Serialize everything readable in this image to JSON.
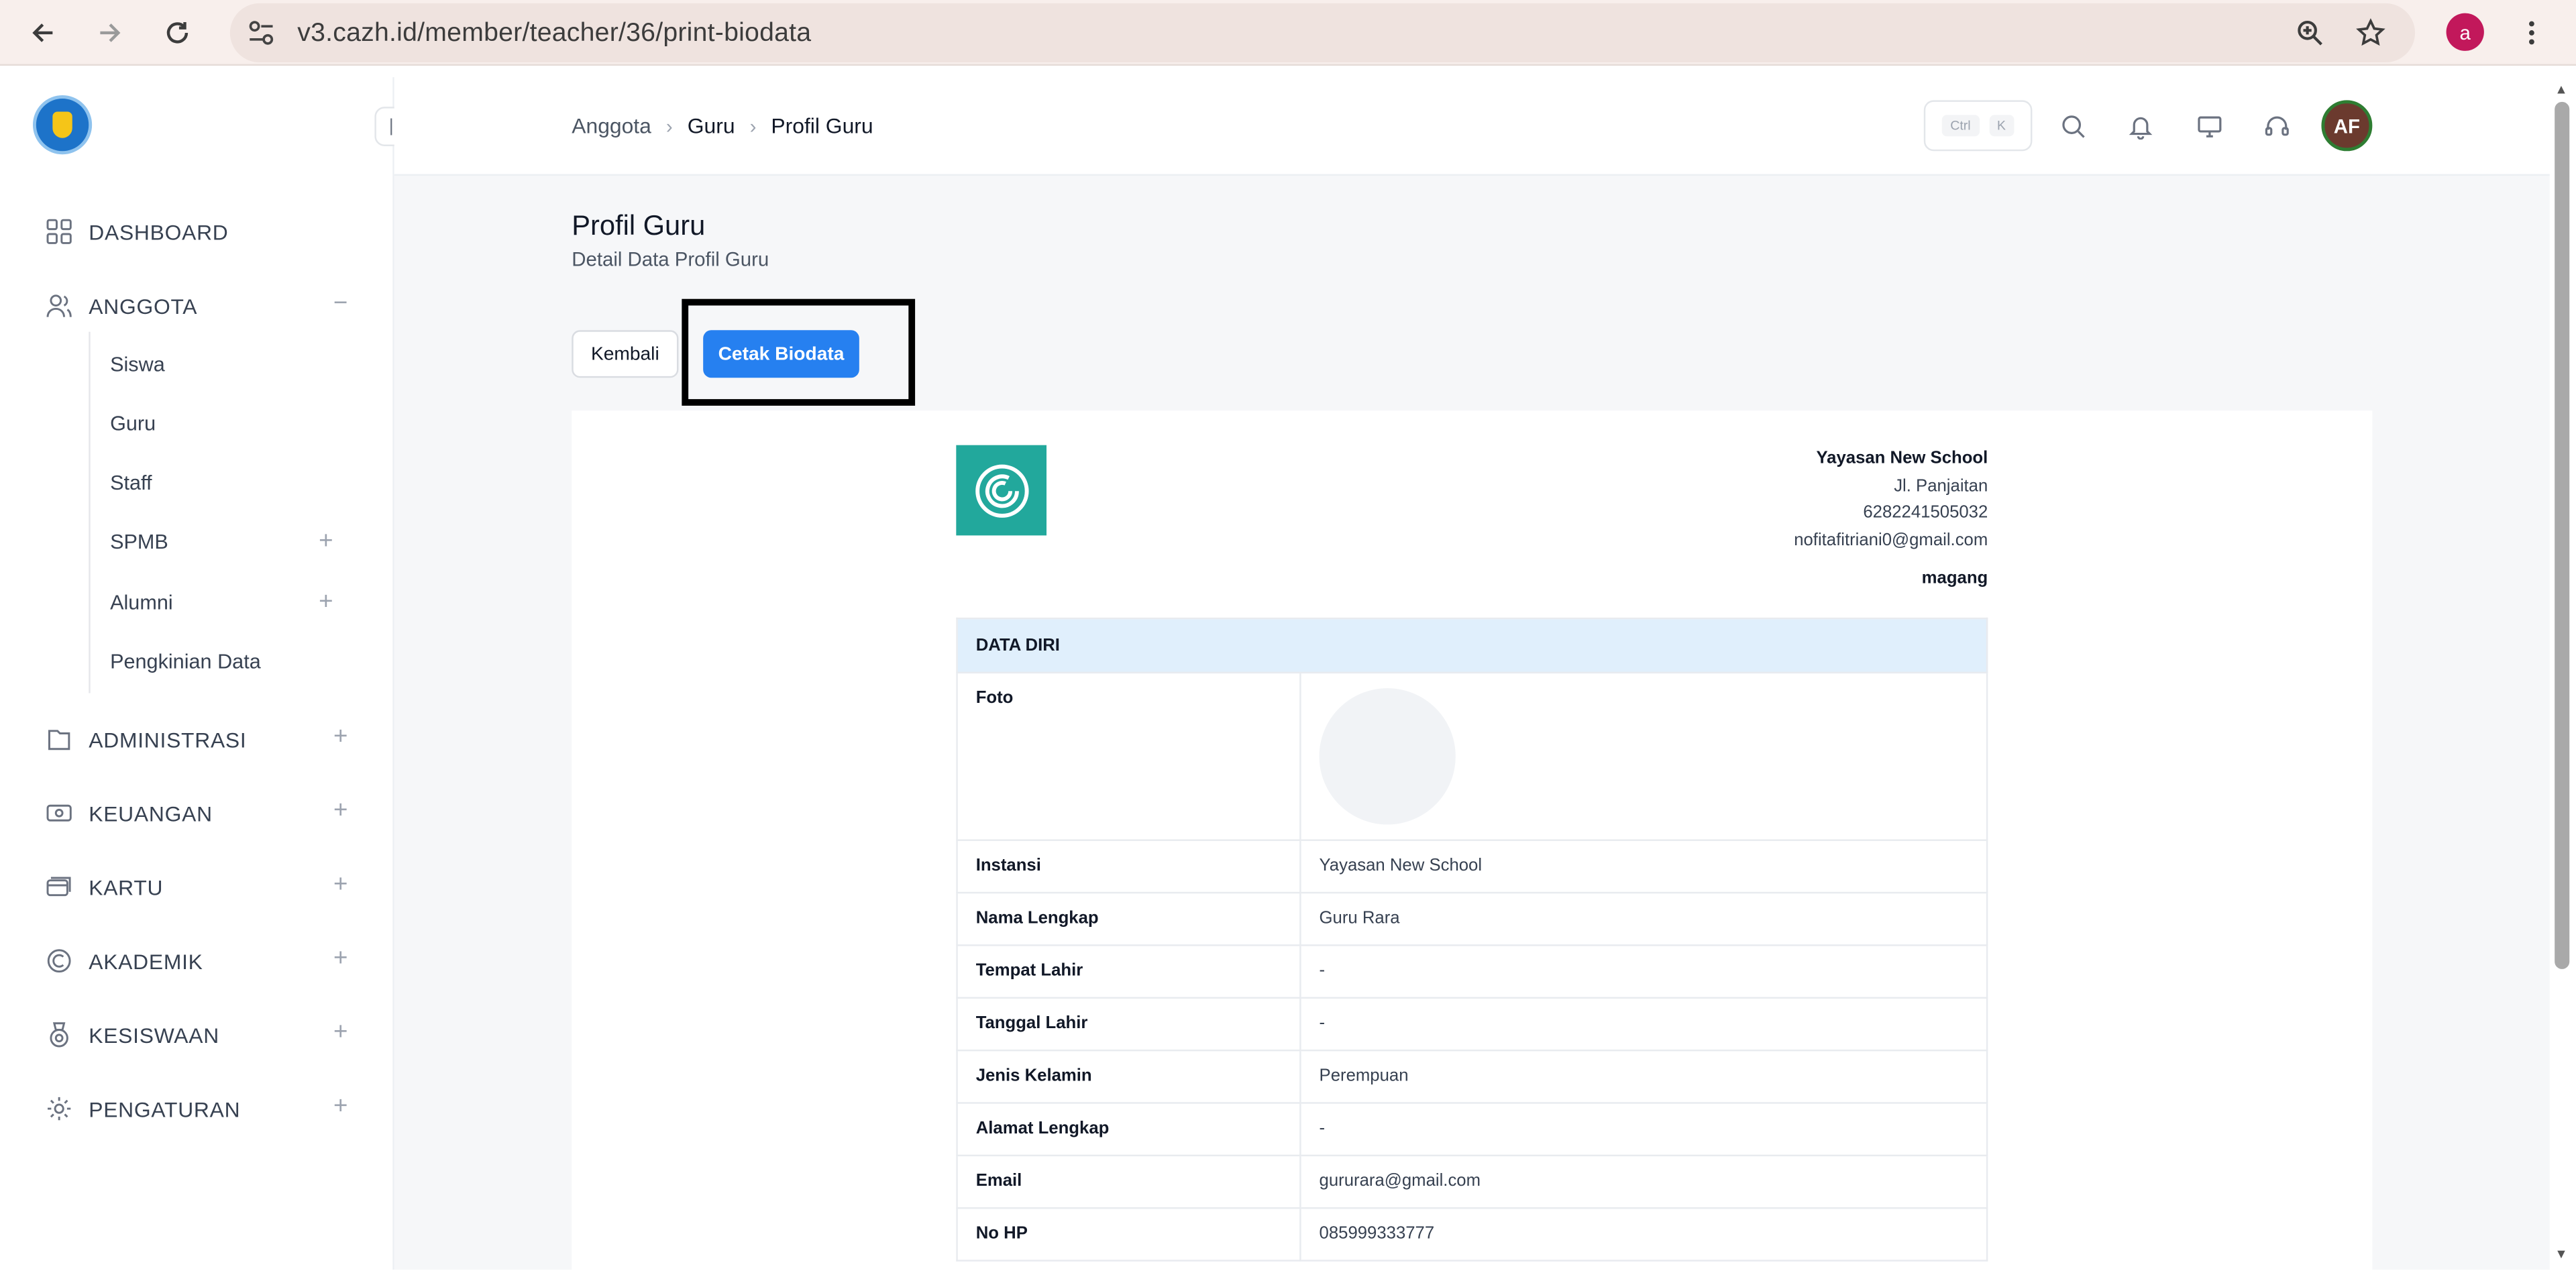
{
  "browser": {
    "url": "v3.cazh.id/member/teacher/36/print-biodata",
    "profile_initial": "a"
  },
  "sidebar": {
    "collapse_icon": "collapse-left-icon",
    "items": [
      {
        "label": "DASHBOARD",
        "icon": "grid-icon",
        "toggle": ""
      },
      {
        "label": "ANGGOTA",
        "icon": "users-icon",
        "toggle": "−"
      },
      {
        "label": "ADMINISTRASI",
        "icon": "folder-icon",
        "toggle": "+"
      },
      {
        "label": "KEUANGAN",
        "icon": "money-icon",
        "toggle": "+"
      },
      {
        "label": "KARTU",
        "icon": "card-icon",
        "toggle": "+"
      },
      {
        "label": "AKADEMIK",
        "icon": "academic-icon",
        "toggle": "+"
      },
      {
        "label": "KESISWAAN",
        "icon": "medal-icon",
        "toggle": "+"
      },
      {
        "label": "PENGATURAN",
        "icon": "gear-icon",
        "toggle": "+"
      }
    ],
    "anggota_sub": [
      {
        "label": "Siswa",
        "toggle": ""
      },
      {
        "label": "Guru",
        "toggle": ""
      },
      {
        "label": "Staff",
        "toggle": ""
      },
      {
        "label": "SPMB",
        "toggle": "+"
      },
      {
        "label": "Alumni",
        "toggle": "+"
      },
      {
        "label": "Pengkinian Data",
        "toggle": ""
      }
    ]
  },
  "header": {
    "breadcrumb": [
      "Anggota",
      "Guru",
      "Profil Guru"
    ],
    "shortcut_ctrl": "Ctrl",
    "shortcut_key": "K",
    "avatar_initials": "AF"
  },
  "page": {
    "title": "Profil Guru",
    "subtitle": "Detail Data Profil Guru",
    "back_label": "Kembali",
    "print_label": "Cetak Biodata"
  },
  "school": {
    "name": "Yayasan New School",
    "address": "Jl. Panjaitan",
    "phone": "6282241505032",
    "email": "nofitafitriani0@gmail.com",
    "tag": "magang"
  },
  "biodata": {
    "section": "DATA DIRI",
    "photo_label": "Foto",
    "rows": [
      {
        "key": "Instansi",
        "value": "Yayasan New School"
      },
      {
        "key": "Nama Lengkap",
        "value": "Guru Rara"
      },
      {
        "key": "Tempat Lahir",
        "value": "-"
      },
      {
        "key": "Tanggal Lahir",
        "value": "-"
      },
      {
        "key": "Jenis Kelamin",
        "value": "Perempuan"
      },
      {
        "key": "Alamat Lengkap",
        "value": "-"
      },
      {
        "key": "Email",
        "value": "gururara@gmail.com"
      },
      {
        "key": "No HP",
        "value": "085999333777"
      }
    ]
  }
}
